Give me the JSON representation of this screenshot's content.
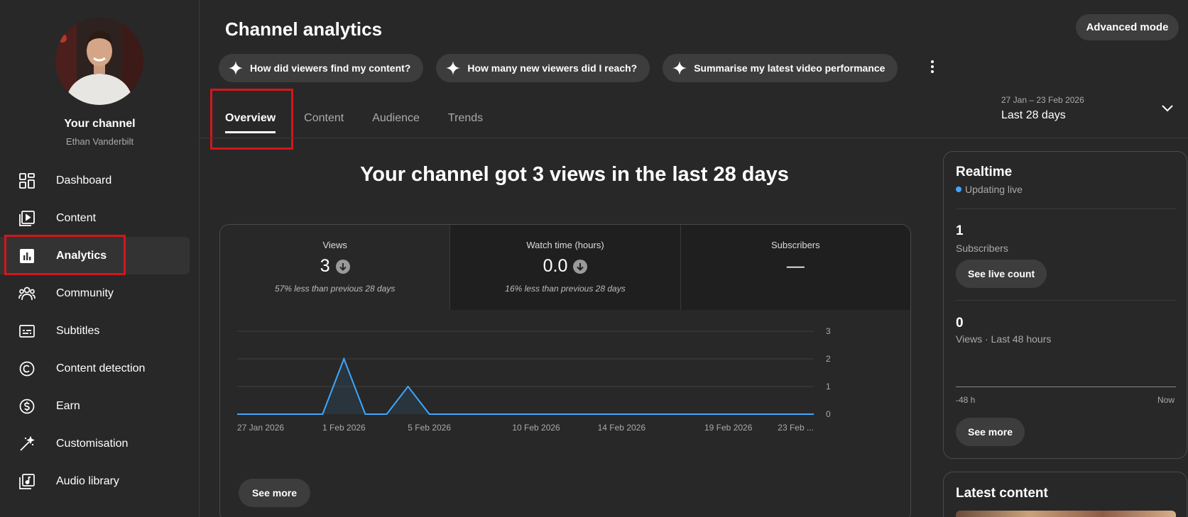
{
  "sidebar": {
    "channel_title": "Your channel",
    "channel_name": "Ethan Vanderbilt",
    "items": [
      {
        "label": "Dashboard",
        "icon": "dashboard-icon"
      },
      {
        "label": "Content",
        "icon": "content-icon"
      },
      {
        "label": "Analytics",
        "icon": "analytics-icon",
        "active": true
      },
      {
        "label": "Community",
        "icon": "community-icon"
      },
      {
        "label": "Subtitles",
        "icon": "subtitles-icon"
      },
      {
        "label": "Content detection",
        "icon": "copyright-icon"
      },
      {
        "label": "Earn",
        "icon": "dollar-icon"
      },
      {
        "label": "Customisation",
        "icon": "magic-wand-icon"
      },
      {
        "label": "Audio library",
        "icon": "audio-library-icon"
      }
    ]
  },
  "header": {
    "title": "Channel analytics",
    "advanced_mode": "Advanced mode",
    "chips": [
      "How did viewers find my content?",
      "How many new viewers did I reach?",
      "Summarise my latest video performance"
    ]
  },
  "tabs": [
    "Overview",
    "Content",
    "Audience",
    "Trends"
  ],
  "date": {
    "range": "27 Jan – 23 Feb 2026",
    "label": "Last 28 days"
  },
  "headline": "Your channel got 3 views in the last 28 days",
  "metrics": [
    {
      "label": "Views",
      "value": "3",
      "note": "57% less than previous 28 days"
    },
    {
      "label": "Watch time (hours)",
      "value": "0.0",
      "note": "16% less than previous 28 days"
    },
    {
      "label": "Subscribers",
      "value": "—",
      "note": ""
    }
  ],
  "see_more": "See more",
  "chart_data": {
    "type": "line",
    "x": [
      "27 Jan 2026",
      "28 Jan",
      "29 Jan",
      "30 Jan",
      "31 Jan",
      "1 Feb 2026",
      "2 Feb",
      "3 Feb",
      "4 Feb",
      "5 Feb 2026",
      "6 Feb",
      "7 Feb",
      "8 Feb",
      "9 Feb",
      "10 Feb 2026",
      "11 Feb",
      "12 Feb",
      "13 Feb",
      "14 Feb 2026",
      "15 Feb",
      "16 Feb",
      "17 Feb",
      "18 Feb",
      "19 Feb 2026",
      "20 Feb",
      "21 Feb",
      "22 Feb",
      "23 Feb 2026"
    ],
    "values": [
      0,
      0,
      0,
      0,
      0,
      2,
      0,
      0,
      1,
      0,
      0,
      0,
      0,
      0,
      0,
      0,
      0,
      0,
      0,
      0,
      0,
      0,
      0,
      0,
      0,
      0,
      0,
      0
    ],
    "tick_labels": [
      "27 Jan 2026",
      "1 Feb 2026",
      "5 Feb 2026",
      "10 Feb 2026",
      "14 Feb 2026",
      "19 Feb 2026",
      "23 Feb ..."
    ],
    "y_ticks": [
      "0",
      "1",
      "2",
      "3"
    ],
    "ylim": [
      0,
      3
    ],
    "color": "#3ea6ff",
    "grid": true
  },
  "realtime": {
    "title": "Realtime",
    "status": "Updating live",
    "subscribers_value": "1",
    "subscribers_label": "Subscribers",
    "see_live_count": "See live count",
    "views_value": "0",
    "views_label": "Views · Last 48 hours",
    "axis_left": "-48 h",
    "axis_right": "Now",
    "see_more": "See more"
  },
  "latest_content": {
    "title": "Latest content"
  }
}
